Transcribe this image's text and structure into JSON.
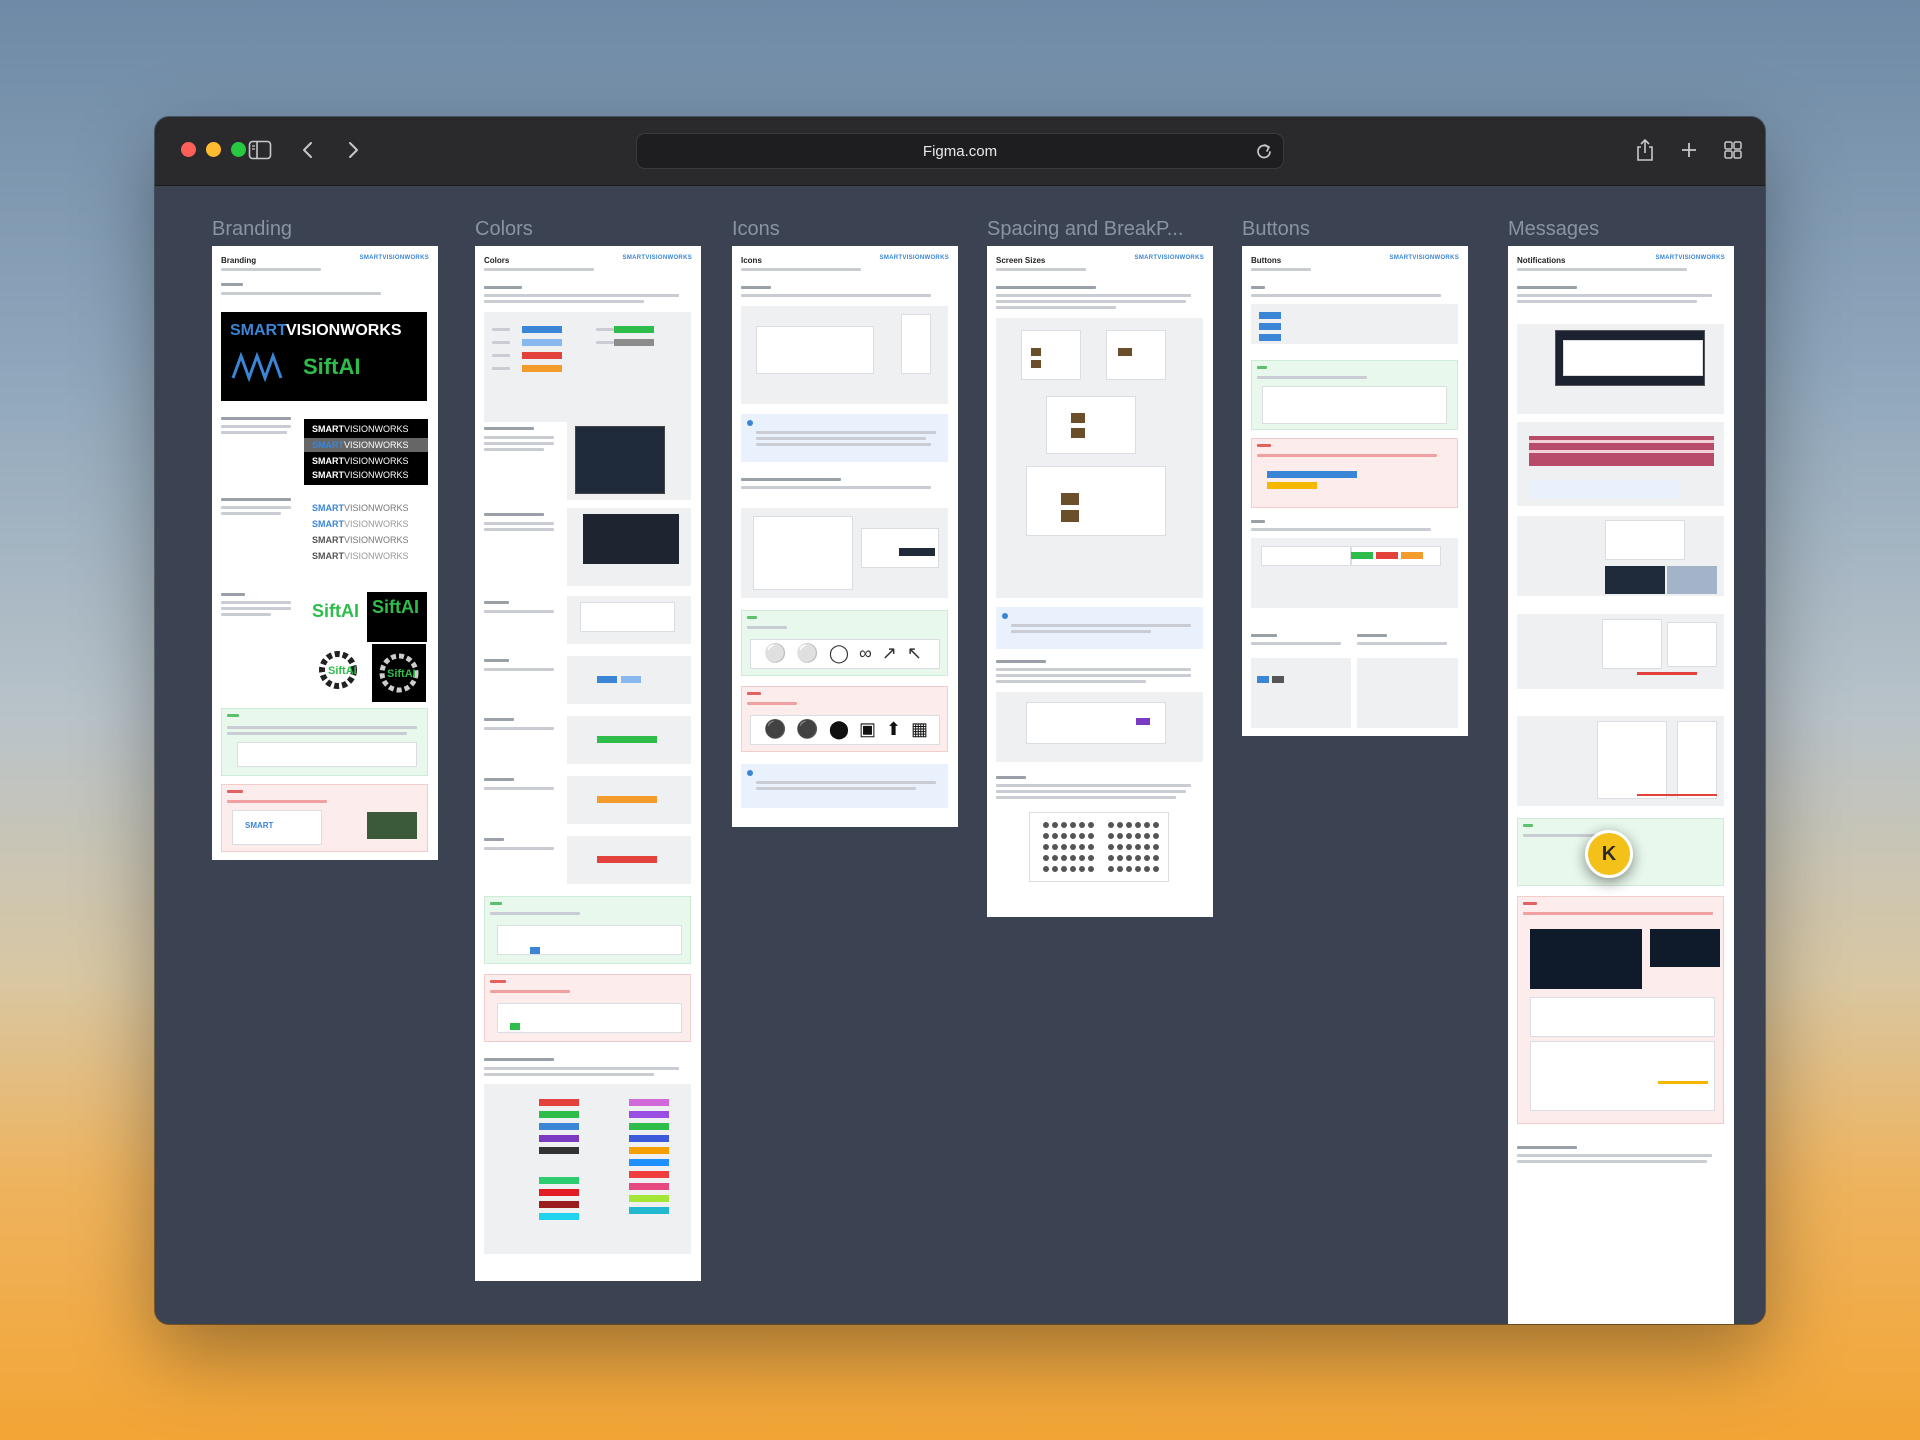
{
  "browser": {
    "url": "Figma.com",
    "icons": {
      "sidebar": "sidebar-icon",
      "back": "chevron-left-icon",
      "forward": "chevron-right-icon",
      "reload": "reload-icon",
      "share": "share-icon",
      "new_tab": "plus-icon",
      "tabs": "tab-overview-icon"
    }
  },
  "frames": [
    {
      "title": "Branding",
      "heading": "Branding"
    },
    {
      "title": "Colors",
      "heading": "Colors"
    },
    {
      "title": "Icons",
      "heading": "Icons"
    },
    {
      "title": "Spacing and BreakP...",
      "heading": "Screen Sizes"
    },
    {
      "title": "Buttons",
      "heading": "Buttons"
    },
    {
      "title": "Messages",
      "heading": "Notifications"
    }
  ],
  "brand_mark": "SMARTVISIONWORKS",
  "branding": {
    "logo_smart": "SMART",
    "logo_vision": "VISIONWORKS",
    "logo_sift": "SiftAI"
  },
  "cursor": {
    "initial": "K",
    "color": "#f4c11a"
  },
  "colors": {
    "accent_blue": "#3a85d6",
    "success_green": "#2ebd4b",
    "warning_orange": "#f39c2c",
    "error_red": "#e3413b"
  }
}
